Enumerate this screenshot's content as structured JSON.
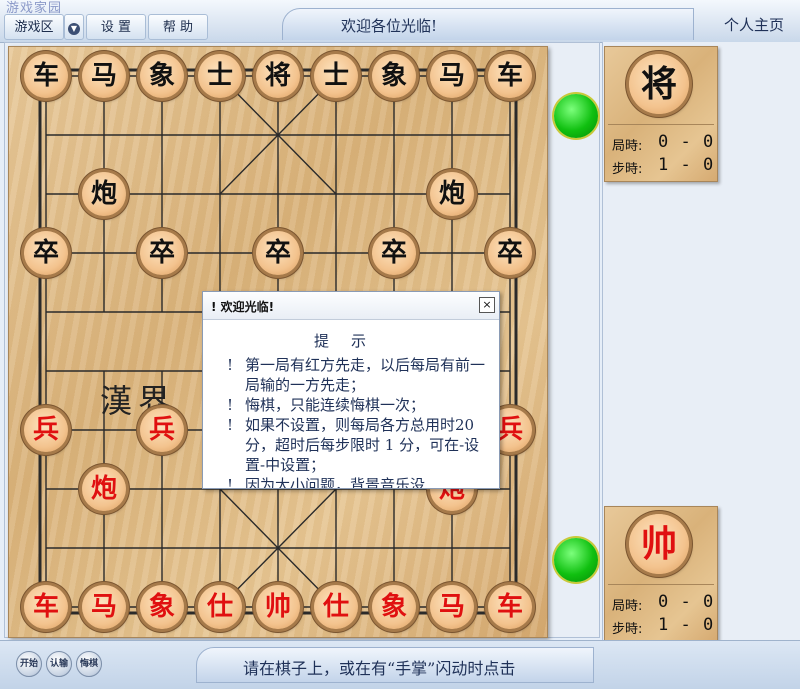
{
  "header": {
    "logo_text": "游戏家园",
    "menu": {
      "games": "游戏区",
      "settings": "设 置",
      "help": "帮 助"
    },
    "welcome": "欢迎各位光临!",
    "homepage": "个人主页"
  },
  "board": {
    "river_left": "漢界",
    "pieces": {
      "black_back": [
        "车",
        "马",
        "象",
        "士",
        "将",
        "士",
        "象",
        "马",
        "车"
      ],
      "black_cannon": "炮",
      "black_soldier": "卒",
      "red_back": [
        "车",
        "马",
        "象",
        "仕",
        "帅",
        "仕",
        "象",
        "马",
        "车"
      ],
      "red_cannon": "炮",
      "red_soldier": "兵"
    }
  },
  "players": {
    "top": {
      "piece": "将",
      "game_time_label": "局時:",
      "game_time": "0 - 0",
      "step_time_label": "步時:",
      "step_time": "1 - 0"
    },
    "bottom": {
      "piece": "帅",
      "game_time_label": "局時:",
      "game_time": "0 - 0",
      "step_time_label": "步時:",
      "step_time": "1 - 0"
    }
  },
  "dialog": {
    "title": "! 欢迎光临!",
    "close": "×",
    "heading": "提示",
    "tip_mark": "!",
    "tips": [
      "第一局有红方先走，以后每局有前一局输的一方先走；",
      "悔棋，只能连续悔棋一次；",
      "如果不设置，则每局各方总用时20分，超时后每步限时 1 分，可在-设置-中设置；",
      "因为大小问题，背景音乐没"
    ]
  },
  "footer": {
    "buttons": {
      "start": "开始",
      "resign": "认输",
      "undo": "悔棋"
    },
    "status": "请在棋子上，或在有“手掌”闪动时点击"
  },
  "colors": {
    "red_piece": "#e01010",
    "black_piece": "#111111",
    "indicator": "#10c010"
  }
}
